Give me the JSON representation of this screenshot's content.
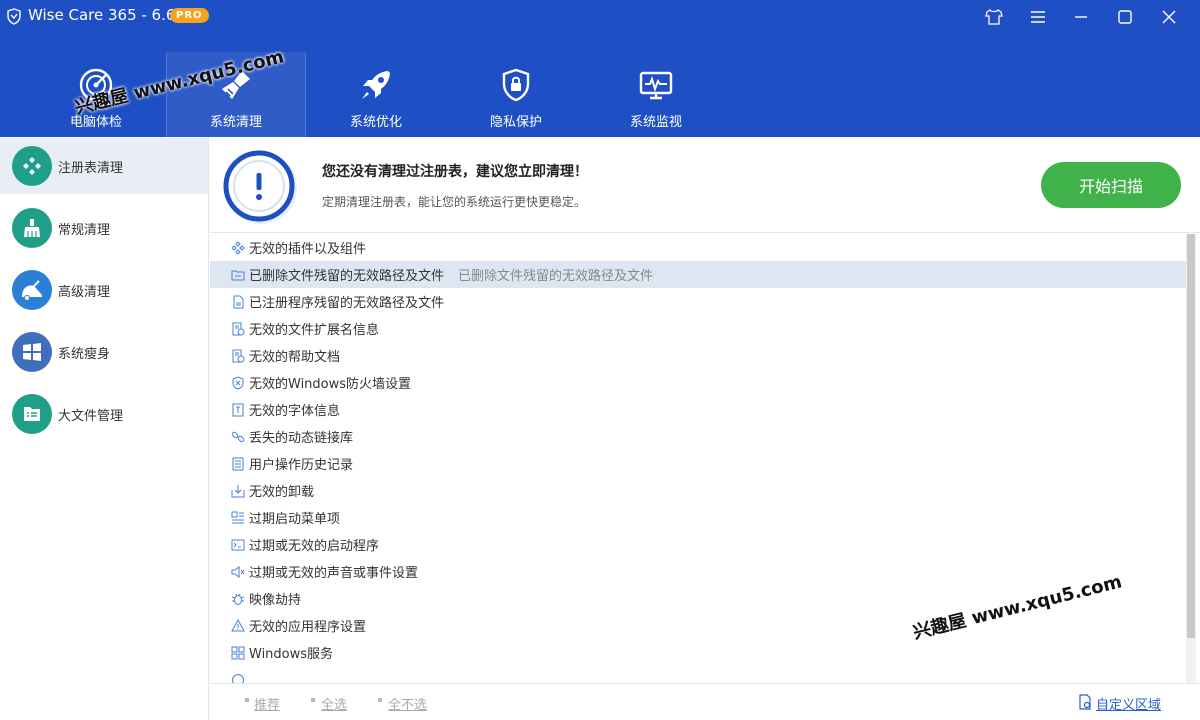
{
  "window": {
    "title": "Wise Care 365 - 6.6.3",
    "badge": "PRO"
  },
  "nav": {
    "tabs": [
      {
        "label": "电脑体检",
        "icon": "radar-icon"
      },
      {
        "label": "系统清理",
        "icon": "broom-icon",
        "active": true
      },
      {
        "label": "系统优化",
        "icon": "rocket-icon"
      },
      {
        "label": "隐私保护",
        "icon": "shield-lock-icon"
      },
      {
        "label": "系统监视",
        "icon": "monitor-pulse-icon"
      }
    ]
  },
  "sidebar": {
    "items": [
      {
        "label": "注册表清理",
        "active": true
      },
      {
        "label": "常规清理"
      },
      {
        "label": "高级清理"
      },
      {
        "label": "系统瘦身"
      },
      {
        "label": "大文件管理"
      }
    ]
  },
  "banner": {
    "title": "您还没有清理过注册表，建议您立即清理！",
    "subtitle": "定期清理注册表，能让您的系统运行更快更稳定。",
    "scan_button": "开始扫描"
  },
  "list": {
    "items": [
      {
        "label": "无效的插件以及组件"
      },
      {
        "label": "已删除文件残留的无效路径及文件",
        "description": "已删除文件残留的无效路径及文件",
        "highlight": true
      },
      {
        "label": "已注册程序残留的无效路径及文件"
      },
      {
        "label": "无效的文件扩展名信息"
      },
      {
        "label": "无效的帮助文档"
      },
      {
        "label": "无效的Windows防火墙设置"
      },
      {
        "label": "无效的字体信息"
      },
      {
        "label": "丢失的动态链接库"
      },
      {
        "label": "用户操作历史记录"
      },
      {
        "label": "无效的卸载"
      },
      {
        "label": "过期启动菜单项"
      },
      {
        "label": "过期或无效的启动程序"
      },
      {
        "label": "过期或无效的声音或事件设置"
      },
      {
        "label": "映像劫持"
      },
      {
        "label": "无效的应用程序设置"
      },
      {
        "label": "Windows服务"
      }
    ]
  },
  "footer": {
    "recommend": "推荐",
    "select_all": "全选",
    "select_none": "全不选",
    "custom_area": "自定义区域"
  },
  "watermark": {
    "text": "兴趣屋 www.xqu5.com"
  },
  "colors": {
    "header": "#1f4fc4",
    "sidebar_icon": "#1f9f8a",
    "scan_button": "#3fb34a",
    "badge": "#f6a21a",
    "highlight_row": "#dde6f1"
  }
}
